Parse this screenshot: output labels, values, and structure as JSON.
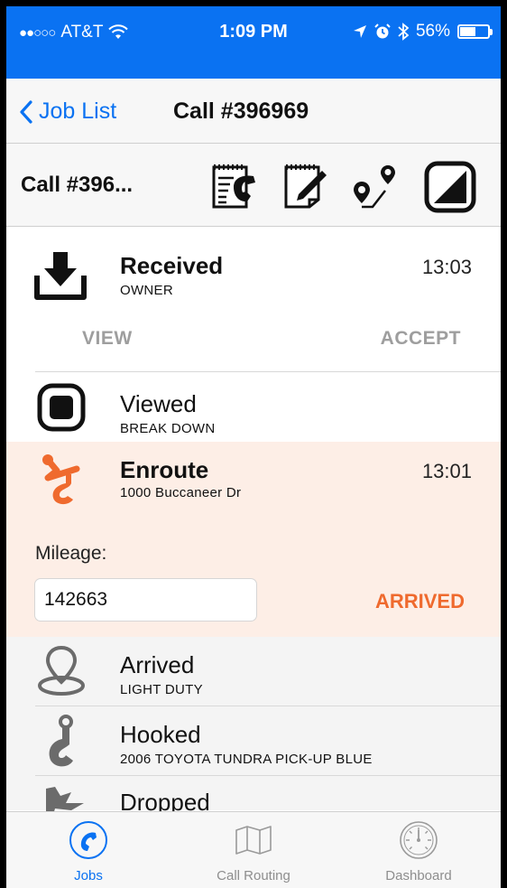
{
  "status_bar": {
    "signal": "●●○○○",
    "carrier": "AT&T",
    "time": "1:09 PM",
    "battery_percent": "56%",
    "battery_level": 0.56
  },
  "nav": {
    "back_label": "Job List",
    "title": "Call #396969"
  },
  "toolbar": {
    "title": "Call #396...",
    "icons": [
      "call-notes-icon",
      "edit-notes-icon",
      "route-pins-icon",
      "half-square-icon"
    ]
  },
  "statuses": [
    {
      "title": "Received",
      "subtitle": "OWNER",
      "time": "13:03",
      "icon": "download-tray-icon",
      "actions": [
        "VIEW",
        "ACCEPT"
      ]
    },
    {
      "title": "Viewed",
      "subtitle": "BREAK DOWN",
      "icon": "square-stop-icon"
    },
    {
      "title": "Enroute",
      "subtitle": "1000 Buccaneer Dr",
      "time": "13:01",
      "icon": "tow-hook-icon"
    },
    {
      "title": "Arrived",
      "subtitle": "LIGHT DUTY",
      "icon": "location-pin-icon"
    },
    {
      "title": "Hooked",
      "subtitle": "2006 TOYOTA TUNDRA PICK-UP BLUE",
      "icon": "hook-icon"
    },
    {
      "title": "Dropped",
      "icon": "flag-icon"
    }
  ],
  "enroute_form": {
    "mileage_label": "Mileage:",
    "mileage_value": "142663",
    "action_label": "ARRIVED"
  },
  "tabs": [
    {
      "label": "Jobs",
      "icon": "phone-circle-icon",
      "active": true
    },
    {
      "label": "Call Routing",
      "icon": "map-icon",
      "active": false
    },
    {
      "label": "Dashboard",
      "icon": "gauge-icon",
      "active": false
    }
  ],
  "colors": {
    "accent_blue": "#0a72f2",
    "accent_orange": "#ef6a2e",
    "enroute_bg": "#fdeee6"
  }
}
